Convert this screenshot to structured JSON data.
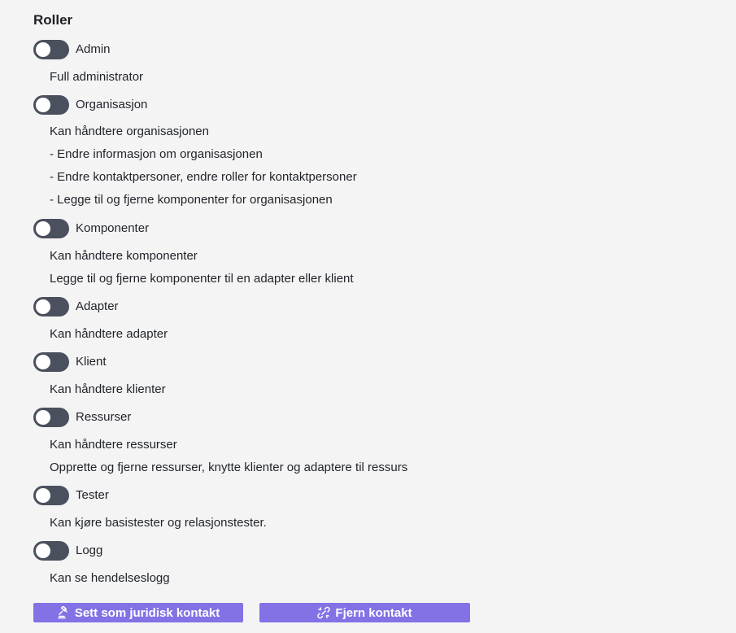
{
  "title": "Roller",
  "roles": [
    {
      "label": "Admin",
      "enabled": false,
      "descriptions": [
        "Full administrator"
      ]
    },
    {
      "label": "Organisasjon",
      "enabled": false,
      "descriptions": [
        "Kan håndtere organisasjonen",
        "- Endre informasjon om organisasjonen",
        "- Endre kontaktpersoner, endre roller for kontaktpersoner",
        "- Legge til og fjerne komponenter for organisasjonen"
      ]
    },
    {
      "label": "Komponenter",
      "enabled": false,
      "descriptions": [
        "Kan håndtere komponenter",
        "Legge til og fjerne komponenter til en adapter eller klient"
      ]
    },
    {
      "label": "Adapter",
      "enabled": false,
      "descriptions": [
        "Kan håndtere adapter"
      ]
    },
    {
      "label": "Klient",
      "enabled": false,
      "descriptions": [
        "Kan håndtere klienter"
      ]
    },
    {
      "label": "Ressurser",
      "enabled": false,
      "descriptions": [
        "Kan håndtere ressurser",
        "Opprette og fjerne ressurser, knytte klienter og adaptere til ressurs"
      ]
    },
    {
      "label": "Tester",
      "enabled": false,
      "descriptions": [
        "Kan kjøre basistester og relasjonstester."
      ]
    },
    {
      "label": "Logg",
      "enabled": false,
      "descriptions": [
        "Kan se hendelseslogg"
      ]
    }
  ],
  "actions": {
    "legal_contact": {
      "label": "Sett som juridisk kontakt",
      "icon": "gavel-icon"
    },
    "remove_contact": {
      "label": "Fjern kontakt",
      "icon": "unlink-icon"
    }
  },
  "colors": {
    "toggle_off": "#4b505e",
    "button_bg": "#8272e6",
    "background": "#f4f4f5"
  }
}
